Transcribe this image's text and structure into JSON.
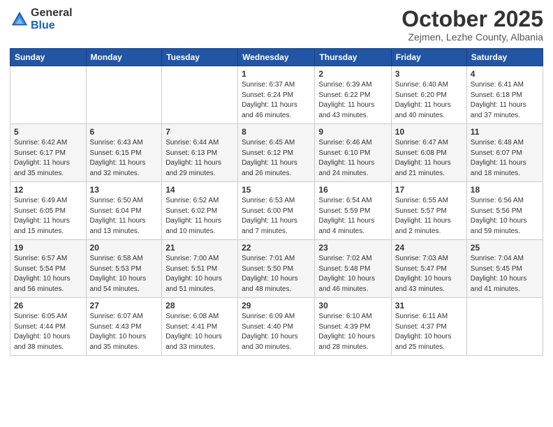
{
  "header": {
    "logo_general": "General",
    "logo_blue": "Blue",
    "main_title": "October 2025",
    "subtitle": "Zejmen, Lezhe County, Albania"
  },
  "days_of_week": [
    "Sunday",
    "Monday",
    "Tuesday",
    "Wednesday",
    "Thursday",
    "Friday",
    "Saturday"
  ],
  "weeks": [
    [
      {
        "day": "",
        "info": ""
      },
      {
        "day": "",
        "info": ""
      },
      {
        "day": "",
        "info": ""
      },
      {
        "day": "1",
        "info": "Sunrise: 6:37 AM\nSunset: 6:24 PM\nDaylight: 11 hours\nand 46 minutes."
      },
      {
        "day": "2",
        "info": "Sunrise: 6:39 AM\nSunset: 6:22 PM\nDaylight: 11 hours\nand 43 minutes."
      },
      {
        "day": "3",
        "info": "Sunrise: 6:40 AM\nSunset: 6:20 PM\nDaylight: 11 hours\nand 40 minutes."
      },
      {
        "day": "4",
        "info": "Sunrise: 6:41 AM\nSunset: 6:18 PM\nDaylight: 11 hours\nand 37 minutes."
      }
    ],
    [
      {
        "day": "5",
        "info": "Sunrise: 6:42 AM\nSunset: 6:17 PM\nDaylight: 11 hours\nand 35 minutes."
      },
      {
        "day": "6",
        "info": "Sunrise: 6:43 AM\nSunset: 6:15 PM\nDaylight: 11 hours\nand 32 minutes."
      },
      {
        "day": "7",
        "info": "Sunrise: 6:44 AM\nSunset: 6:13 PM\nDaylight: 11 hours\nand 29 minutes."
      },
      {
        "day": "8",
        "info": "Sunrise: 6:45 AM\nSunset: 6:12 PM\nDaylight: 11 hours\nand 26 minutes."
      },
      {
        "day": "9",
        "info": "Sunrise: 6:46 AM\nSunset: 6:10 PM\nDaylight: 11 hours\nand 24 minutes."
      },
      {
        "day": "10",
        "info": "Sunrise: 6:47 AM\nSunset: 6:08 PM\nDaylight: 11 hours\nand 21 minutes."
      },
      {
        "day": "11",
        "info": "Sunrise: 6:48 AM\nSunset: 6:07 PM\nDaylight: 11 hours\nand 18 minutes."
      }
    ],
    [
      {
        "day": "12",
        "info": "Sunrise: 6:49 AM\nSunset: 6:05 PM\nDaylight: 11 hours\nand 15 minutes."
      },
      {
        "day": "13",
        "info": "Sunrise: 6:50 AM\nSunset: 6:04 PM\nDaylight: 11 hours\nand 13 minutes."
      },
      {
        "day": "14",
        "info": "Sunrise: 6:52 AM\nSunset: 6:02 PM\nDaylight: 11 hours\nand 10 minutes."
      },
      {
        "day": "15",
        "info": "Sunrise: 6:53 AM\nSunset: 6:00 PM\nDaylight: 11 hours\nand 7 minutes."
      },
      {
        "day": "16",
        "info": "Sunrise: 6:54 AM\nSunset: 5:59 PM\nDaylight: 11 hours\nand 4 minutes."
      },
      {
        "day": "17",
        "info": "Sunrise: 6:55 AM\nSunset: 5:57 PM\nDaylight: 11 hours\nand 2 minutes."
      },
      {
        "day": "18",
        "info": "Sunrise: 6:56 AM\nSunset: 5:56 PM\nDaylight: 10 hours\nand 59 minutes."
      }
    ],
    [
      {
        "day": "19",
        "info": "Sunrise: 6:57 AM\nSunset: 5:54 PM\nDaylight: 10 hours\nand 56 minutes."
      },
      {
        "day": "20",
        "info": "Sunrise: 6:58 AM\nSunset: 5:53 PM\nDaylight: 10 hours\nand 54 minutes."
      },
      {
        "day": "21",
        "info": "Sunrise: 7:00 AM\nSunset: 5:51 PM\nDaylight: 10 hours\nand 51 minutes."
      },
      {
        "day": "22",
        "info": "Sunrise: 7:01 AM\nSunset: 5:50 PM\nDaylight: 10 hours\nand 48 minutes."
      },
      {
        "day": "23",
        "info": "Sunrise: 7:02 AM\nSunset: 5:48 PM\nDaylight: 10 hours\nand 46 minutes."
      },
      {
        "day": "24",
        "info": "Sunrise: 7:03 AM\nSunset: 5:47 PM\nDaylight: 10 hours\nand 43 minutes."
      },
      {
        "day": "25",
        "info": "Sunrise: 7:04 AM\nSunset: 5:45 PM\nDaylight: 10 hours\nand 41 minutes."
      }
    ],
    [
      {
        "day": "26",
        "info": "Sunrise: 6:05 AM\nSunset: 4:44 PM\nDaylight: 10 hours\nand 38 minutes."
      },
      {
        "day": "27",
        "info": "Sunrise: 6:07 AM\nSunset: 4:43 PM\nDaylight: 10 hours\nand 35 minutes."
      },
      {
        "day": "28",
        "info": "Sunrise: 6:08 AM\nSunset: 4:41 PM\nDaylight: 10 hours\nand 33 minutes."
      },
      {
        "day": "29",
        "info": "Sunrise: 6:09 AM\nSunset: 4:40 PM\nDaylight: 10 hours\nand 30 minutes."
      },
      {
        "day": "30",
        "info": "Sunrise: 6:10 AM\nSunset: 4:39 PM\nDaylight: 10 hours\nand 28 minutes."
      },
      {
        "day": "31",
        "info": "Sunrise: 6:11 AM\nSunset: 4:37 PM\nDaylight: 10 hours\nand 25 minutes."
      },
      {
        "day": "",
        "info": ""
      }
    ]
  ]
}
